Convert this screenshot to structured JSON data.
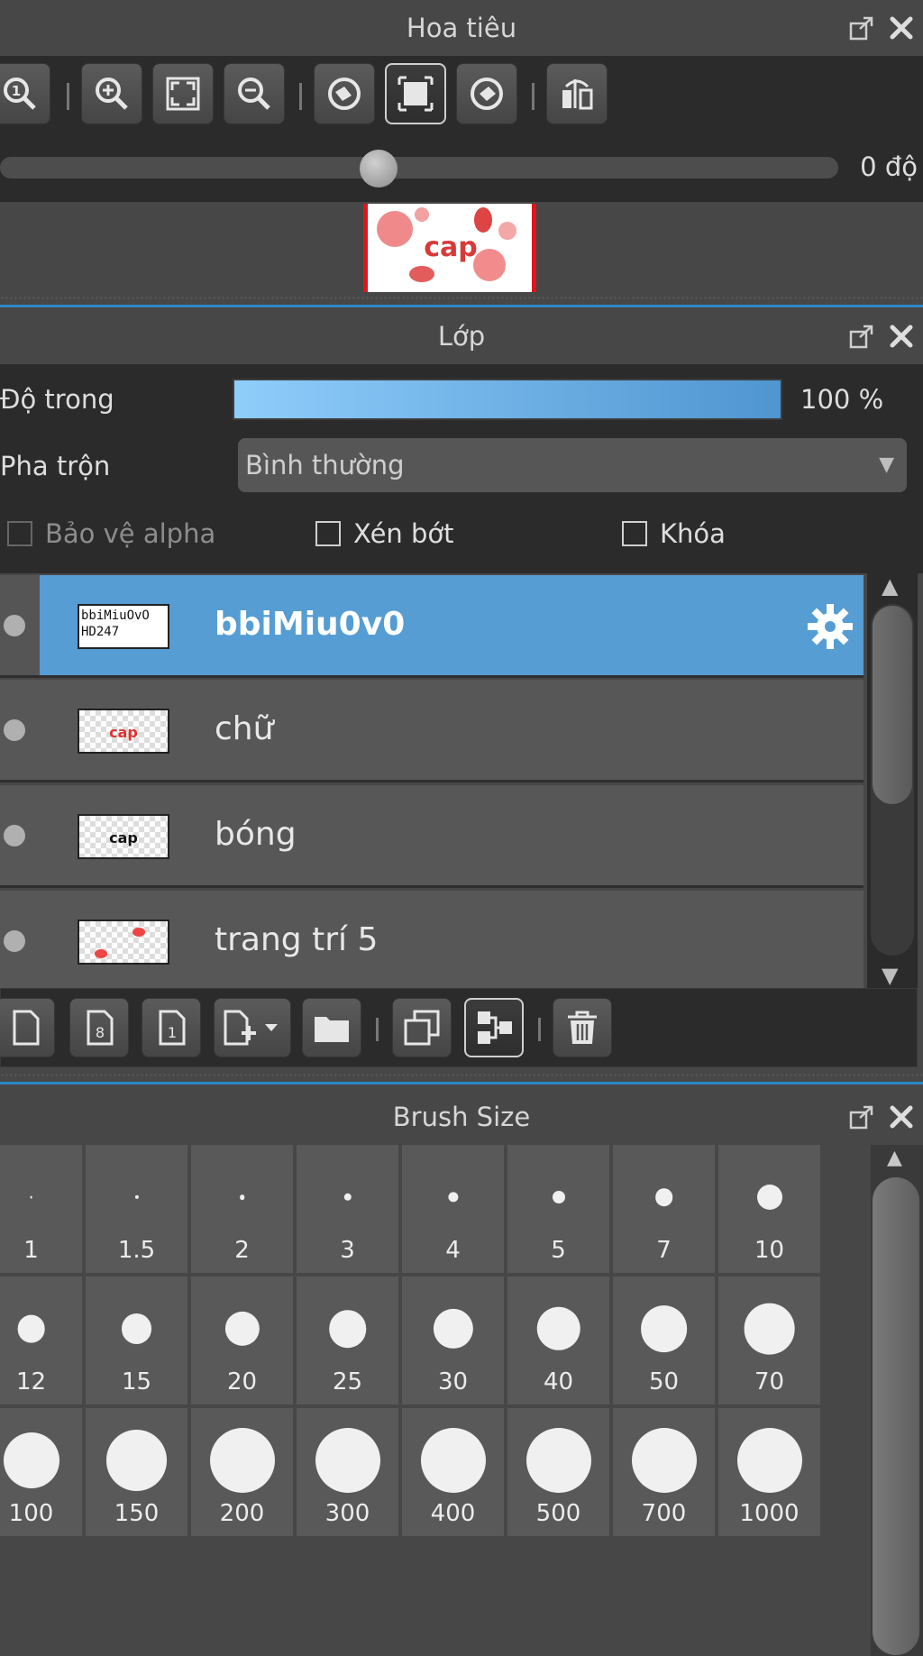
{
  "navigator": {
    "title": "Hoa tiêu",
    "rotation_label": "0 độ",
    "rotation_degrees": 0,
    "toolbar_icons": [
      "zoom-actual-icon",
      "zoom-in-icon",
      "fit-screen-icon",
      "zoom-out-icon",
      "rotate-left-icon",
      "fit-window-icon",
      "rotate-right-icon",
      "flip-horizontal-icon"
    ]
  },
  "layers": {
    "title": "Lớp",
    "opacity_label": "Độ trong",
    "opacity_value": "100 %",
    "opacity_fraction": 1.0,
    "blend_label": "Pha trộn",
    "blend_value": "Bình thường",
    "protect_alpha_label": "Bảo vệ alpha",
    "clip_label": "Xén bớt",
    "lock_label": "Khóa",
    "thumb_text": "bbiMiuOvO HD247",
    "items": [
      {
        "name": "bbiMiu0v0",
        "selected": true
      },
      {
        "name": "chữ",
        "selected": false
      },
      {
        "name": "bóng",
        "selected": false
      },
      {
        "name": "trang trí 5",
        "selected": false
      }
    ],
    "toolbar_icons": [
      "new-layer-icon",
      "new-8bit-layer-icon",
      "new-1bit-layer-icon",
      "add-layer-dropdown-icon",
      "folder-icon",
      "duplicate-icon",
      "merge-icon",
      "trash-icon"
    ]
  },
  "brush": {
    "title": "Brush Size",
    "sizes": [
      "1",
      "1.5",
      "2",
      "3",
      "4",
      "5",
      "7",
      "10",
      "12",
      "15",
      "20",
      "25",
      "30",
      "40",
      "50",
      "70",
      "100",
      "150",
      "200",
      "300",
      "400",
      "500",
      "700",
      "1000"
    ]
  },
  "colors": {
    "accent": "#559dd3",
    "panel_bg": "#474747",
    "toolbar_bg": "#2b2b2b",
    "preview_border": "#e0141a"
  }
}
